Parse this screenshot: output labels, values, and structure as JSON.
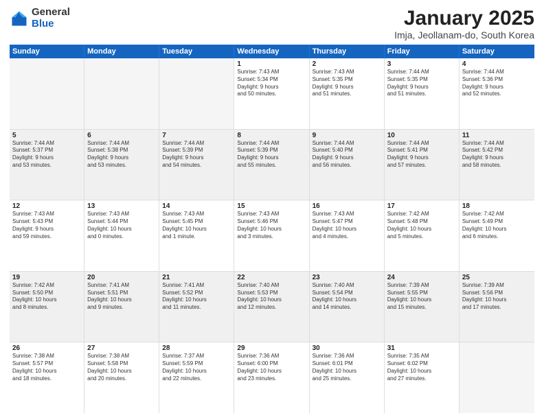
{
  "logo": {
    "general": "General",
    "blue": "Blue"
  },
  "title": "January 2025",
  "subtitle": "Imja, Jeollanam-do, South Korea",
  "headers": [
    "Sunday",
    "Monday",
    "Tuesday",
    "Wednesday",
    "Thursday",
    "Friday",
    "Saturday"
  ],
  "weeks": [
    [
      {
        "day": "",
        "text": "",
        "empty": true
      },
      {
        "day": "",
        "text": "",
        "empty": true
      },
      {
        "day": "",
        "text": "",
        "empty": true
      },
      {
        "day": "1",
        "text": "Sunrise: 7:43 AM\nSunset: 5:34 PM\nDaylight: 9 hours\nand 50 minutes."
      },
      {
        "day": "2",
        "text": "Sunrise: 7:43 AM\nSunset: 5:35 PM\nDaylight: 9 hours\nand 51 minutes."
      },
      {
        "day": "3",
        "text": "Sunrise: 7:44 AM\nSunset: 5:35 PM\nDaylight: 9 hours\nand 51 minutes."
      },
      {
        "day": "4",
        "text": "Sunrise: 7:44 AM\nSunset: 5:36 PM\nDaylight: 9 hours\nand 52 minutes."
      }
    ],
    [
      {
        "day": "5",
        "text": "Sunrise: 7:44 AM\nSunset: 5:37 PM\nDaylight: 9 hours\nand 53 minutes."
      },
      {
        "day": "6",
        "text": "Sunrise: 7:44 AM\nSunset: 5:38 PM\nDaylight: 9 hours\nand 53 minutes."
      },
      {
        "day": "7",
        "text": "Sunrise: 7:44 AM\nSunset: 5:39 PM\nDaylight: 9 hours\nand 54 minutes."
      },
      {
        "day": "8",
        "text": "Sunrise: 7:44 AM\nSunset: 5:39 PM\nDaylight: 9 hours\nand 55 minutes."
      },
      {
        "day": "9",
        "text": "Sunrise: 7:44 AM\nSunset: 5:40 PM\nDaylight: 9 hours\nand 56 minutes."
      },
      {
        "day": "10",
        "text": "Sunrise: 7:44 AM\nSunset: 5:41 PM\nDaylight: 9 hours\nand 57 minutes."
      },
      {
        "day": "11",
        "text": "Sunrise: 7:44 AM\nSunset: 5:42 PM\nDaylight: 9 hours\nand 58 minutes."
      }
    ],
    [
      {
        "day": "12",
        "text": "Sunrise: 7:43 AM\nSunset: 5:43 PM\nDaylight: 9 hours\nand 59 minutes."
      },
      {
        "day": "13",
        "text": "Sunrise: 7:43 AM\nSunset: 5:44 PM\nDaylight: 10 hours\nand 0 minutes."
      },
      {
        "day": "14",
        "text": "Sunrise: 7:43 AM\nSunset: 5:45 PM\nDaylight: 10 hours\nand 1 minute."
      },
      {
        "day": "15",
        "text": "Sunrise: 7:43 AM\nSunset: 5:46 PM\nDaylight: 10 hours\nand 3 minutes."
      },
      {
        "day": "16",
        "text": "Sunrise: 7:43 AM\nSunset: 5:47 PM\nDaylight: 10 hours\nand 4 minutes."
      },
      {
        "day": "17",
        "text": "Sunrise: 7:42 AM\nSunset: 5:48 PM\nDaylight: 10 hours\nand 5 minutes."
      },
      {
        "day": "18",
        "text": "Sunrise: 7:42 AM\nSunset: 5:49 PM\nDaylight: 10 hours\nand 6 minutes."
      }
    ],
    [
      {
        "day": "19",
        "text": "Sunrise: 7:42 AM\nSunset: 5:50 PM\nDaylight: 10 hours\nand 8 minutes."
      },
      {
        "day": "20",
        "text": "Sunrise: 7:41 AM\nSunset: 5:51 PM\nDaylight: 10 hours\nand 9 minutes."
      },
      {
        "day": "21",
        "text": "Sunrise: 7:41 AM\nSunset: 5:52 PM\nDaylight: 10 hours\nand 11 minutes."
      },
      {
        "day": "22",
        "text": "Sunrise: 7:40 AM\nSunset: 5:53 PM\nDaylight: 10 hours\nand 12 minutes."
      },
      {
        "day": "23",
        "text": "Sunrise: 7:40 AM\nSunset: 5:54 PM\nDaylight: 10 hours\nand 14 minutes."
      },
      {
        "day": "24",
        "text": "Sunrise: 7:39 AM\nSunset: 5:55 PM\nDaylight: 10 hours\nand 15 minutes."
      },
      {
        "day": "25",
        "text": "Sunrise: 7:39 AM\nSunset: 5:56 PM\nDaylight: 10 hours\nand 17 minutes."
      }
    ],
    [
      {
        "day": "26",
        "text": "Sunrise: 7:38 AM\nSunset: 5:57 PM\nDaylight: 10 hours\nand 18 minutes."
      },
      {
        "day": "27",
        "text": "Sunrise: 7:38 AM\nSunset: 5:58 PM\nDaylight: 10 hours\nand 20 minutes."
      },
      {
        "day": "28",
        "text": "Sunrise: 7:37 AM\nSunset: 5:59 PM\nDaylight: 10 hours\nand 22 minutes."
      },
      {
        "day": "29",
        "text": "Sunrise: 7:36 AM\nSunset: 6:00 PM\nDaylight: 10 hours\nand 23 minutes."
      },
      {
        "day": "30",
        "text": "Sunrise: 7:36 AM\nSunset: 6:01 PM\nDaylight: 10 hours\nand 25 minutes."
      },
      {
        "day": "31",
        "text": "Sunrise: 7:35 AM\nSunset: 6:02 PM\nDaylight: 10 hours\nand 27 minutes."
      },
      {
        "day": "",
        "text": "",
        "empty": true
      }
    ]
  ]
}
